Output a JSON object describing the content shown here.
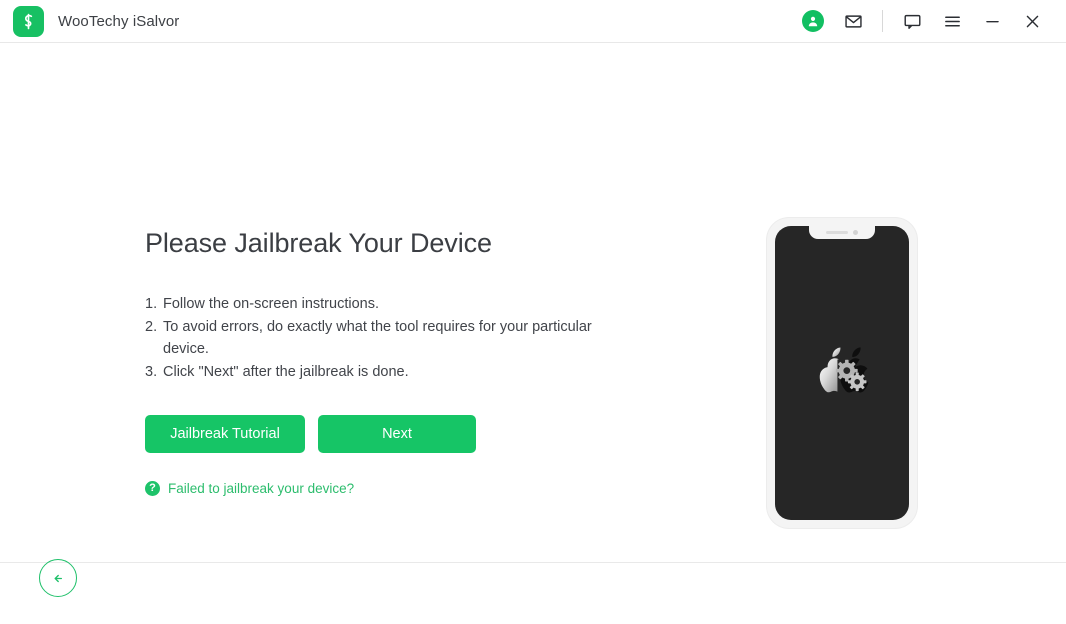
{
  "window": {
    "app_name": "WooTechy iSalvor",
    "logo_icon": "isalvor-logo-icon",
    "accent_color": "#16c566",
    "title_text_color": "#3d4045"
  },
  "titlebar": {
    "actions": [
      {
        "name": "account-icon",
        "label": "Account",
        "icon": "user-avatar-icon"
      },
      {
        "name": "mail-icon",
        "label": "Mail",
        "icon": "envelope-icon"
      },
      {
        "name": "feedback-icon",
        "label": "Feedback",
        "icon": "chat-bubble-icon"
      },
      {
        "name": "menu-icon",
        "label": "Menu",
        "icon": "hamburger-menu-icon"
      },
      {
        "name": "minimize-button",
        "label": "Minimize",
        "icon": "minimize-icon"
      },
      {
        "name": "close-button",
        "label": "Close",
        "icon": "close-x-icon"
      }
    ]
  },
  "main": {
    "title": "Please Jailbreak Your Device",
    "steps": [
      {
        "num": "1.",
        "text": "Follow the on-screen instructions."
      },
      {
        "num": "2.",
        "text": "To avoid errors, do exactly what the tool requires for your particular device."
      },
      {
        "num": "3.",
        "text": "Click \"Next\" after the jailbreak is done."
      }
    ],
    "buttons": {
      "tutorial_label": "Jailbreak Tutorial",
      "next_label": "Next"
    },
    "help": {
      "icon": "question-mark-icon",
      "text": "Failed to jailbreak your device?",
      "color": "#2cbd6d"
    }
  },
  "illustration": {
    "device": "iphone-with-notch",
    "screen_content": "apple-logo-with-gears",
    "screen_color": "#262626",
    "body_color": "#f4f4f4"
  },
  "footer": {
    "back_button_label": "Back",
    "back_icon": "arrow-left-icon"
  }
}
